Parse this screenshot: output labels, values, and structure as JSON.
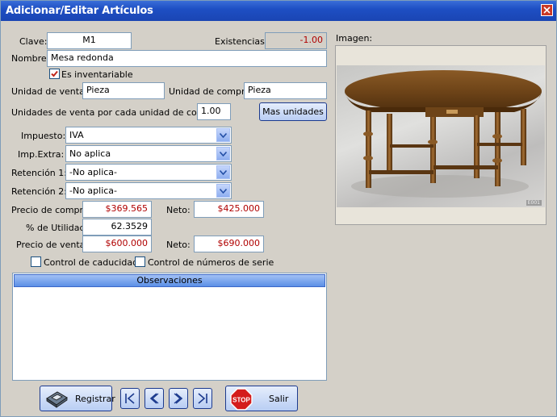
{
  "window": {
    "title": "Adicionar/Editar Artículos"
  },
  "form": {
    "clave_label": "Clave:",
    "clave_value": "M1",
    "existencias_label": "Existencias:",
    "existencias_value": "-1.00",
    "nombre_label": "Nombre:",
    "nombre_value": "Mesa redonda",
    "inventariable_label": "Es inventariable",
    "inventariable_checked": true,
    "unidad_venta_label": "Unidad de venta:",
    "unidad_venta_value": "Pieza",
    "unidad_compra_label": "Unidad de compra:",
    "unidad_compra_value": "Pieza",
    "unidades_por_compra_label": "Unidades de venta por cada unidad de compra:",
    "unidades_por_compra_value": "1.00",
    "mas_unidades_label": "Mas unidades",
    "impuesto_label": "Impuesto:",
    "impuesto_value": "IVA",
    "imp_extra_label": "Imp.Extra:",
    "imp_extra_value": "No aplica",
    "retencion1_label": "Retención 1:",
    "retencion1_value": "-No aplica-",
    "retencion2_label": "Retención 2:",
    "retencion2_value": "-No aplica-",
    "precio_compra_label": "Precio de compra:",
    "precio_compra_value": "$369.565",
    "neto_label": "Neto:",
    "neto_compra_value": "$425.000",
    "utilidad_label": "% de Utilidad:",
    "utilidad_value": "62.3529",
    "precio_venta_label": "Precio de venta:",
    "precio_venta_value": "$600.000",
    "neto_venta_value": "$690.000",
    "caducidad_label": "Control de caducidad",
    "caducidad_checked": false,
    "series_label": "Control de números de serie",
    "series_checked": false,
    "observaciones_label": "Observaciones",
    "observaciones_value": ""
  },
  "image": {
    "label": "Imagen:",
    "watermark": "E001"
  },
  "footer": {
    "registrar_label": "Registrar",
    "stop_label": "STOP",
    "salir_label": "Salir"
  },
  "colors": {
    "titlebar": "#1e4fc4",
    "red_value": "#b00000",
    "accent": "#5b8fe6"
  },
  "icons": [
    "close-icon",
    "dropdown-arrow-icon",
    "floppy-disk-icon",
    "first-record-icon",
    "previous-record-icon",
    "next-record-icon",
    "last-record-icon",
    "stop-sign-icon",
    "checkmark-icon"
  ]
}
